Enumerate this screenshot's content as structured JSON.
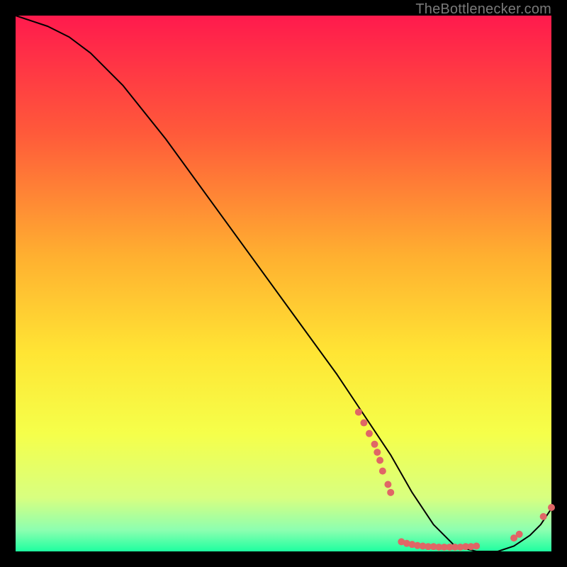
{
  "watermark": "TheBottlenecker.com",
  "chart_data": {
    "type": "line",
    "title": "",
    "xlabel": "",
    "ylabel": "",
    "xlim": [
      0,
      100
    ],
    "ylim": [
      0,
      100
    ],
    "gradient_stops": [
      {
        "pct": 0,
        "color": "#ff1a4d"
      },
      {
        "pct": 22,
        "color": "#ff5a3a"
      },
      {
        "pct": 45,
        "color": "#ffb030"
      },
      {
        "pct": 63,
        "color": "#ffe534"
      },
      {
        "pct": 78,
        "color": "#f5ff4a"
      },
      {
        "pct": 90,
        "color": "#d8ff80"
      },
      {
        "pct": 96,
        "color": "#8dffb0"
      },
      {
        "pct": 100,
        "color": "#1effa0"
      }
    ],
    "series": [
      {
        "name": "bottleneck-curve",
        "color": "#000000",
        "width": 2,
        "x": [
          0,
          3,
          6,
          10,
          14,
          20,
          28,
          36,
          44,
          52,
          60,
          66,
          70,
          74,
          78,
          82,
          86,
          90,
          93,
          96,
          98,
          100
        ],
        "y": [
          100,
          99,
          98,
          96,
          93,
          87,
          77,
          66,
          55,
          44,
          33,
          24,
          18,
          11,
          5,
          1,
          0,
          0,
          1,
          3,
          5,
          8
        ]
      }
    ],
    "scatter": [
      {
        "name": "marker-cluster",
        "color": "#e06666",
        "radius": 5,
        "points": [
          [
            64,
            26
          ],
          [
            65,
            24
          ],
          [
            66,
            22
          ],
          [
            67,
            20
          ],
          [
            67.5,
            18.5
          ],
          [
            68,
            17
          ],
          [
            68.5,
            15
          ],
          [
            69.5,
            12.5
          ],
          [
            70,
            11
          ],
          [
            72,
            1.8
          ],
          [
            73,
            1.5
          ],
          [
            74,
            1.3
          ],
          [
            75,
            1.1
          ],
          [
            76,
            1.0
          ],
          [
            77,
            0.9
          ],
          [
            78,
            0.9
          ],
          [
            79,
            0.8
          ],
          [
            80,
            0.8
          ],
          [
            81,
            0.8
          ],
          [
            82,
            0.8
          ],
          [
            83,
            0.8
          ],
          [
            84,
            0.9
          ],
          [
            85,
            0.9
          ],
          [
            86,
            1.0
          ],
          [
            93,
            2.5
          ],
          [
            94,
            3.2
          ],
          [
            98.5,
            6.5
          ],
          [
            100,
            8.2
          ]
        ]
      }
    ]
  }
}
